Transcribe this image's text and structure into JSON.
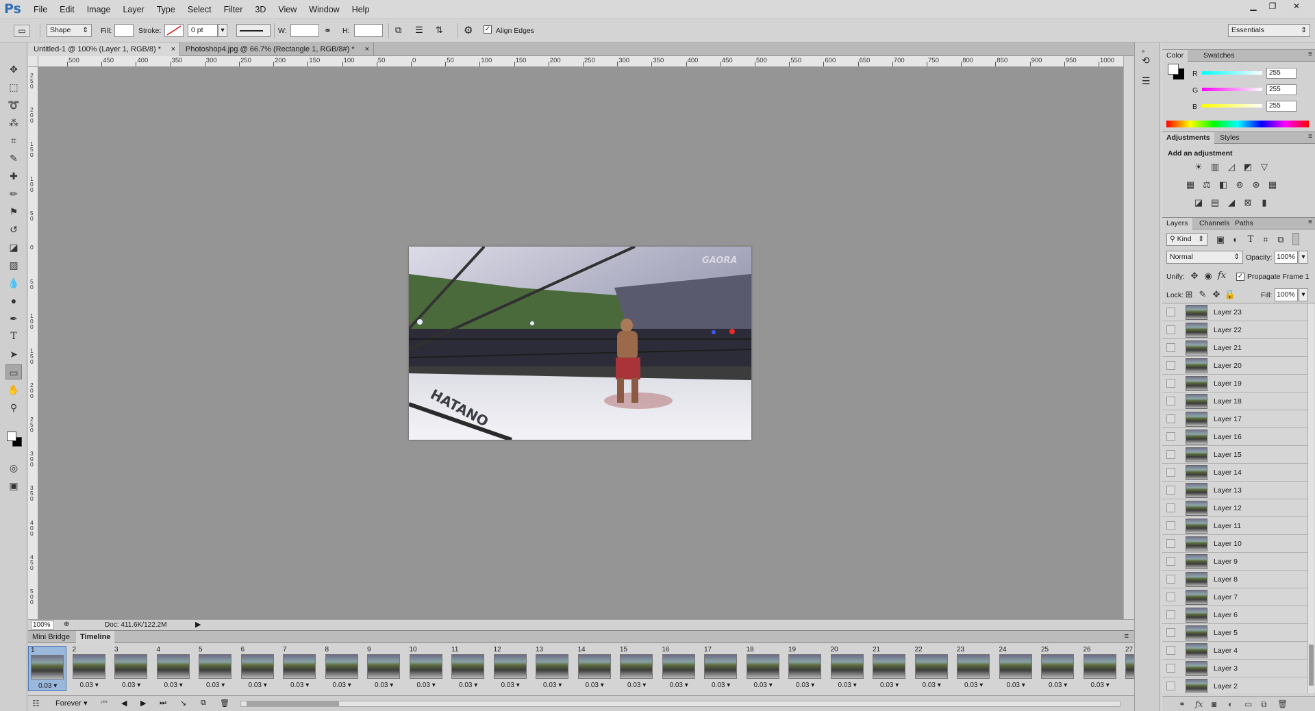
{
  "app": {
    "logo": "Ps"
  },
  "menu": [
    "File",
    "Edit",
    "Image",
    "Layer",
    "Type",
    "Select",
    "Filter",
    "3D",
    "View",
    "Window",
    "Help"
  ],
  "window_controls": {
    "minimize": "▁",
    "restore": "❐",
    "close": "✕"
  },
  "options": {
    "mode": "Shape",
    "fill_label": "Fill:",
    "stroke_label": "Stroke:",
    "stroke_width": "0 pt",
    "w_label": "W:",
    "h_label": "H:",
    "align_edges": "Align Edges",
    "workspace": "Essentials"
  },
  "doc_tabs": [
    {
      "label": "Untitled-1 @ 100% (Layer 1, RGB/8) *"
    },
    {
      "label": "Photoshop4.jpg @ 66.7% (Rectangle 1, RGB/8#) *"
    }
  ],
  "ruler_top": [
    "500",
    "450",
    "400",
    "350",
    "300",
    "250",
    "200",
    "150",
    "100",
    "50",
    "0",
    "50",
    "100",
    "150",
    "200",
    "250",
    "300",
    "350",
    "400",
    "450",
    "500",
    "550",
    "600",
    "650",
    "700",
    "750",
    "800",
    "850",
    "900",
    "950",
    "1000"
  ],
  "ruler_left": [
    "2\n5\n0",
    "2\n0\n0",
    "1\n5\n0",
    "1\n0\n0",
    "5\n0",
    "0",
    "5\n0",
    "1\n0\n0",
    "1\n5\n0",
    "2\n0\n0",
    "2\n5\n0",
    "3\n0\n0",
    "3\n5\n0",
    "4\n0\n0",
    "4\n5\n0",
    "5\n0\n0"
  ],
  "canvas": {
    "watermark": "GAORA",
    "ring_text": "HATANO"
  },
  "status": {
    "zoom": "100%",
    "doc": "Doc: 411.6K/122.2M"
  },
  "panel_tabs": {
    "mini_bridge": "Mini Bridge",
    "timeline": "Timeline"
  },
  "frames": [
    {
      "n": "1",
      "d": "0.03"
    },
    {
      "n": "2",
      "d": "0.03"
    },
    {
      "n": "3",
      "d": "0.03"
    },
    {
      "n": "4",
      "d": "0.03"
    },
    {
      "n": "5",
      "d": "0.03"
    },
    {
      "n": "6",
      "d": "0.03"
    },
    {
      "n": "7",
      "d": "0.03"
    },
    {
      "n": "8",
      "d": "0.03"
    },
    {
      "n": "9",
      "d": "0.03"
    },
    {
      "n": "10",
      "d": "0.03"
    },
    {
      "n": "11",
      "d": "0.03"
    },
    {
      "n": "12",
      "d": "0.03"
    },
    {
      "n": "13",
      "d": "0.03"
    },
    {
      "n": "14",
      "d": "0.03"
    },
    {
      "n": "15",
      "d": "0.03"
    },
    {
      "n": "16",
      "d": "0.03"
    },
    {
      "n": "17",
      "d": "0.03"
    },
    {
      "n": "18",
      "d": "0.03"
    },
    {
      "n": "19",
      "d": "0.03"
    },
    {
      "n": "20",
      "d": "0.03"
    },
    {
      "n": "21",
      "d": "0.03"
    },
    {
      "n": "22",
      "d": "0.03"
    },
    {
      "n": "23",
      "d": "0.03"
    },
    {
      "n": "24",
      "d": "0.03"
    },
    {
      "n": "25",
      "d": "0.03"
    },
    {
      "n": "26",
      "d": "0.03"
    },
    {
      "n": "27",
      "d": ""
    }
  ],
  "timeline_controls": {
    "loop": "Forever"
  },
  "color_panel": {
    "tabs": [
      "Color",
      "Swatches"
    ],
    "r_label": "R",
    "g_label": "G",
    "b_label": "B",
    "r": "255",
    "g": "255",
    "b": "255"
  },
  "adjustments_panel": {
    "tabs": [
      "Adjustments",
      "Styles"
    ],
    "heading": "Add an adjustment"
  },
  "layers_panel": {
    "tabs": [
      "Layers",
      "Channels",
      "Paths"
    ],
    "kind": "Kind",
    "blend_mode": "Normal",
    "opacity_label": "Opacity:",
    "opacity": "100%",
    "unify_label": "Unify:",
    "propagate": "Propagate Frame 1",
    "lock_label": "Lock:",
    "fill_label": "Fill:",
    "fill": "100%",
    "layers": [
      "Layer 23",
      "Layer 22",
      "Layer 21",
      "Layer 20",
      "Layer 19",
      "Layer 18",
      "Layer 17",
      "Layer 16",
      "Layer 15",
      "Layer 14",
      "Layer 13",
      "Layer 12",
      "Layer 11",
      "Layer 10",
      "Layer 9",
      "Layer 8",
      "Layer 7",
      "Layer 6",
      "Layer 5",
      "Layer 4",
      "Layer 3",
      "Layer 2"
    ]
  }
}
